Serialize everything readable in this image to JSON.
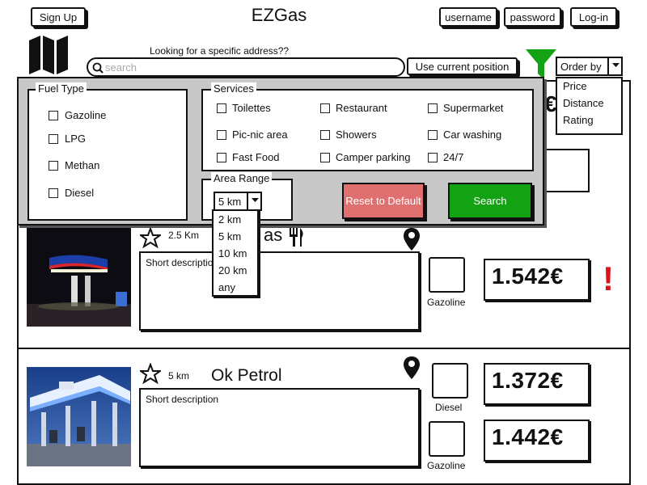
{
  "header": {
    "signup_label": "Sign Up",
    "app_title": "EZGas",
    "username_label": "username",
    "password_label": "password",
    "login_label": "Log-in"
  },
  "search": {
    "prompt": "Looking for a specific address??",
    "placeholder": "search",
    "use_position_label": "Use current position"
  },
  "order": {
    "label": "Order by",
    "options": [
      "Price",
      "Distance",
      "Rating"
    ]
  },
  "filters": {
    "fuel_type_title": "Fuel Type",
    "fuel_types": [
      "Gazoline",
      "LPG",
      "Methan",
      "Diesel"
    ],
    "services_title": "Services",
    "services": [
      "Toilettes",
      "Restaurant",
      "Supermarket",
      "Pic-nic area",
      "Showers",
      "Car washing",
      "Fast Food",
      "Camper parking",
      "24/7"
    ],
    "area_range_title": "Area Range",
    "area_range_value": "5 km",
    "area_range_options": [
      "2 km",
      "5 km",
      "10 km",
      "20 km",
      "any"
    ],
    "reset_label": "Reset to Default",
    "search_label": "Search"
  },
  "stations": [
    {
      "distance": "2.5 Km",
      "name_partial": "as",
      "description": "Short description",
      "prices": [
        {
          "fuel": "Gazoline",
          "price": "1.542€"
        }
      ],
      "alert": "!"
    },
    {
      "distance": "5 km",
      "name": "Ok Petrol",
      "description": "Short description",
      "prices": [
        {
          "fuel": "Diesel",
          "price": "1.372€"
        },
        {
          "fuel": "Gazoline",
          "price": "1.442€"
        }
      ]
    }
  ],
  "hidden_price_fragments": [
    "€",
    "€"
  ],
  "colors": {
    "panel_bg": "#c8c8c8",
    "reset_bg": "#e07070",
    "search_bg": "#13a213",
    "filter_icon": "#13a213",
    "alert": "#d9141b"
  }
}
